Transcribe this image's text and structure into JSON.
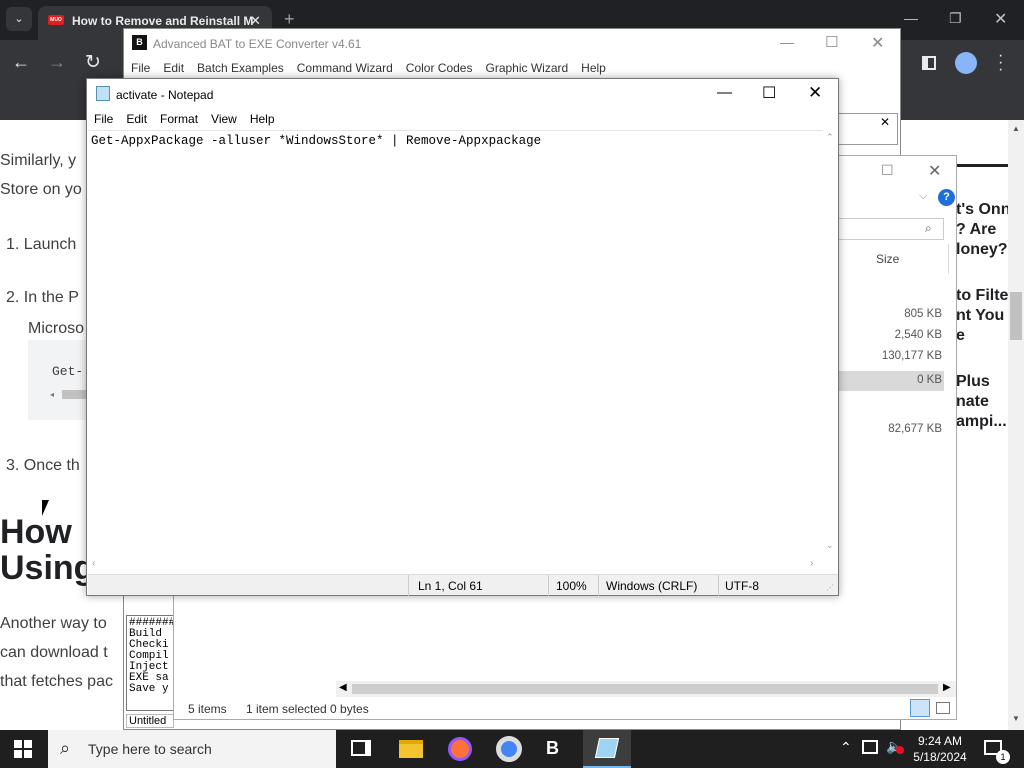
{
  "browser": {
    "tab_title": "How to Remove and Reinstall M",
    "tab_favicon": "MUO",
    "new_tab": "+",
    "back": "←",
    "forward": "→",
    "reload": "↻"
  },
  "webpage": {
    "para1_l1": "Similarly, y",
    "para1_l2": "Store on yo",
    "step1": "1.  Launch",
    "step2_l1": "2.  In the P",
    "step2_l2": "Microso",
    "code": "Get-",
    "step3": "3.  Once th",
    "heading_l1": "How",
    "heading_l2": "Using",
    "para2_l1": "Another way to",
    "para2_l2": "can download t",
    "para2_l3": "that fetches pac",
    "side1_l1": "t's Onn",
    "side1_l2": "? Are",
    "side1_l3": "loney?",
    "side2_l1": "to Filte",
    "side2_l2": "nt You",
    "side2_l3": "e",
    "side3_l1": "Plus",
    "side3_l2": "nate",
    "side3_l3": "ampi..."
  },
  "bat_converter": {
    "title": "Advanced BAT to EXE Converter v4.61",
    "menu": [
      "File",
      "Edit",
      "Batch Examples",
      "Command Wizard",
      "Color Codes",
      "Graphic Wizard",
      "Help"
    ],
    "log_lines": [
      "#######",
      "Build",
      "Checki",
      "Compil",
      "Inject",
      "EXE sa",
      "Save y"
    ],
    "status": "Untitled"
  },
  "explorer": {
    "size_header": "Size",
    "sizes": [
      "805 KB",
      "2,540 KB",
      "130,177 KB",
      "0 KB",
      "",
      "82,677 KB"
    ],
    "status_items": "5 items",
    "status_selected": "1 item selected  0 bytes"
  },
  "notepad": {
    "title": "activate - Notepad",
    "menu": [
      "File",
      "Edit",
      "Format",
      "View",
      "Help"
    ],
    "content": "Get-AppxPackage -alluser *WindowsStore* | Remove-Appxpackage",
    "status_pos": "Ln 1, Col 61",
    "status_zoom": "100%",
    "status_eol": "Windows (CRLF)",
    "status_enc": "UTF-8"
  },
  "taskbar": {
    "search_placeholder": "Type here to search",
    "time": "9:24 AM",
    "date": "5/18/2024",
    "notif_count": "1"
  }
}
